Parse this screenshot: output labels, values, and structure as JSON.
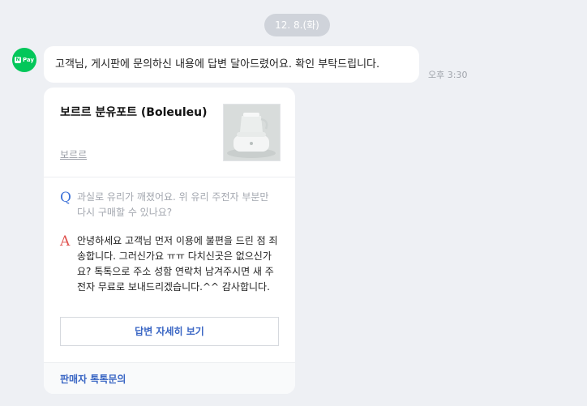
{
  "date_label": "12. 8.(화)",
  "sender": {
    "avatar_text": "Pay",
    "avatar_n": "N"
  },
  "message": {
    "text": "고객님, 게시판에 문의하신 내용에 답변 달아드렸어요. 확인 부탁드립니다.",
    "time": "오후 3:30"
  },
  "card": {
    "product_name": "보르르 분유포트 (Boleuleu)",
    "brand": "보르르",
    "question_mark": "Q",
    "question": "과실로 유리가 깨졌어요. 위 유리 주전자 부분만 다시 구매할 수 있나요?",
    "answer_mark": "A",
    "answer": "안녕하세요 고객님 먼저 이용에 불편을 드린 점 죄송합니다. 그러신가요 ㅠㅠ 다치신곳은 없으신가요? 톡톡으로 주소 성함 연락처 남겨주시면 새 주전자 무료로 보내드리겠습니다.^^ 감사합니다.",
    "detail_button": "답변 자세히 보기",
    "footer_link": "판매자 톡톡문의"
  },
  "colors": {
    "background": "#eef0f4",
    "naver_green": "#03c75a",
    "link_blue": "#3a66c4",
    "question_blue": "#3f73d8",
    "answer_red": "#e0534f"
  },
  "icons": {
    "avatar": "naver-pay-logo",
    "thumbnail": "baby-formula-kettle-image"
  }
}
